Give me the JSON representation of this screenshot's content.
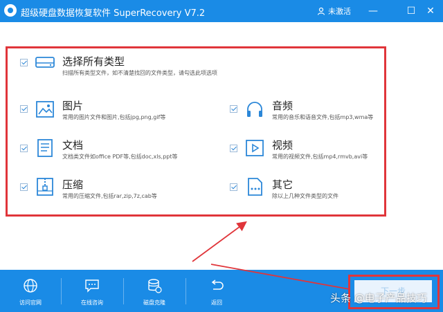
{
  "window": {
    "title": "超级硬盘数据恢复软件 SuperRecovery V7.2",
    "user_status": "未激活",
    "minimize": "—",
    "maximize": "☐",
    "close": "✕"
  },
  "file_types": {
    "all": {
      "label": "选择所有类型",
      "desc": "扫描所有类型文件，如不清楚找回的文件类型，请勾选此项选项",
      "icon": "hard-drive-icon",
      "checked": true
    },
    "items": [
      {
        "label": "图片",
        "desc": "常用的图片文件和图片,包括jpg,png,gif等",
        "icon": "image-icon",
        "checked": true
      },
      {
        "label": "音频",
        "desc": "常用的音乐和语音文件,包括mp3,wma等",
        "icon": "headphones-icon",
        "checked": true
      },
      {
        "label": "文档",
        "desc": "文档类文件如office PDF等,包括doc,xls,ppt等",
        "icon": "document-icon",
        "checked": true
      },
      {
        "label": "视频",
        "desc": "常用的视频文件,包括mp4,rmvb,avi等",
        "icon": "video-icon",
        "checked": true
      },
      {
        "label": "压缩",
        "desc": "常用的压缩文件,包括rar,zip,7z,cab等",
        "icon": "archive-icon",
        "checked": true
      },
      {
        "label": "其它",
        "desc": "除以上几种文件类型的文件",
        "icon": "other-file-icon",
        "checked": true
      }
    ]
  },
  "bottom_nav": [
    {
      "label": "访问官网",
      "icon": "globe-icon"
    },
    {
      "label": "在线咨询",
      "icon": "chat-icon"
    },
    {
      "label": "磁盘克隆",
      "icon": "disk-clone-icon"
    },
    {
      "label": "返回",
      "icon": "back-icon"
    }
  ],
  "next_button": {
    "label": "下一步"
  },
  "watermark": "头条 @电子产品技巧",
  "colors": {
    "brand_blue": "#1a8be6",
    "highlight_red": "#e0353a",
    "icon_blue": "#2b87d8"
  }
}
